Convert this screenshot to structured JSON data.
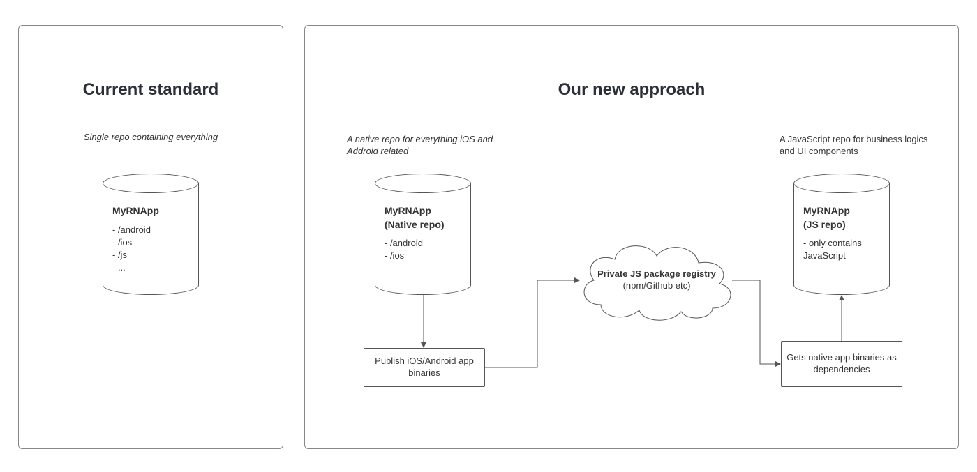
{
  "left": {
    "title": "Current standard",
    "subtitle": "Single repo containing everything",
    "repo": {
      "name": "MyRNApp",
      "items": [
        "- /android",
        "- /ios",
        "- /js",
        "- ..."
      ]
    }
  },
  "right": {
    "title": "Our new approach",
    "nativeSubtitle": "A native repo for everything iOS and Addroid related",
    "jsSubtitle": "A JavaScript repo for business logics and UI components",
    "nativeRepo": {
      "name": "MyRNApp",
      "paren": "(Native repo)",
      "items": [
        "- /android",
        "- /ios"
      ]
    },
    "jsRepo": {
      "name": "MyRNApp",
      "paren": "(JS repo)",
      "items": [
        "- only contains JavaScript"
      ]
    },
    "publishBox": "Publish iOS/Android app binaries",
    "getsBox": "Gets native app binaries as dependencies",
    "cloud": {
      "title": "Private JS package registry",
      "sub": "(npm/Github etc)"
    }
  }
}
